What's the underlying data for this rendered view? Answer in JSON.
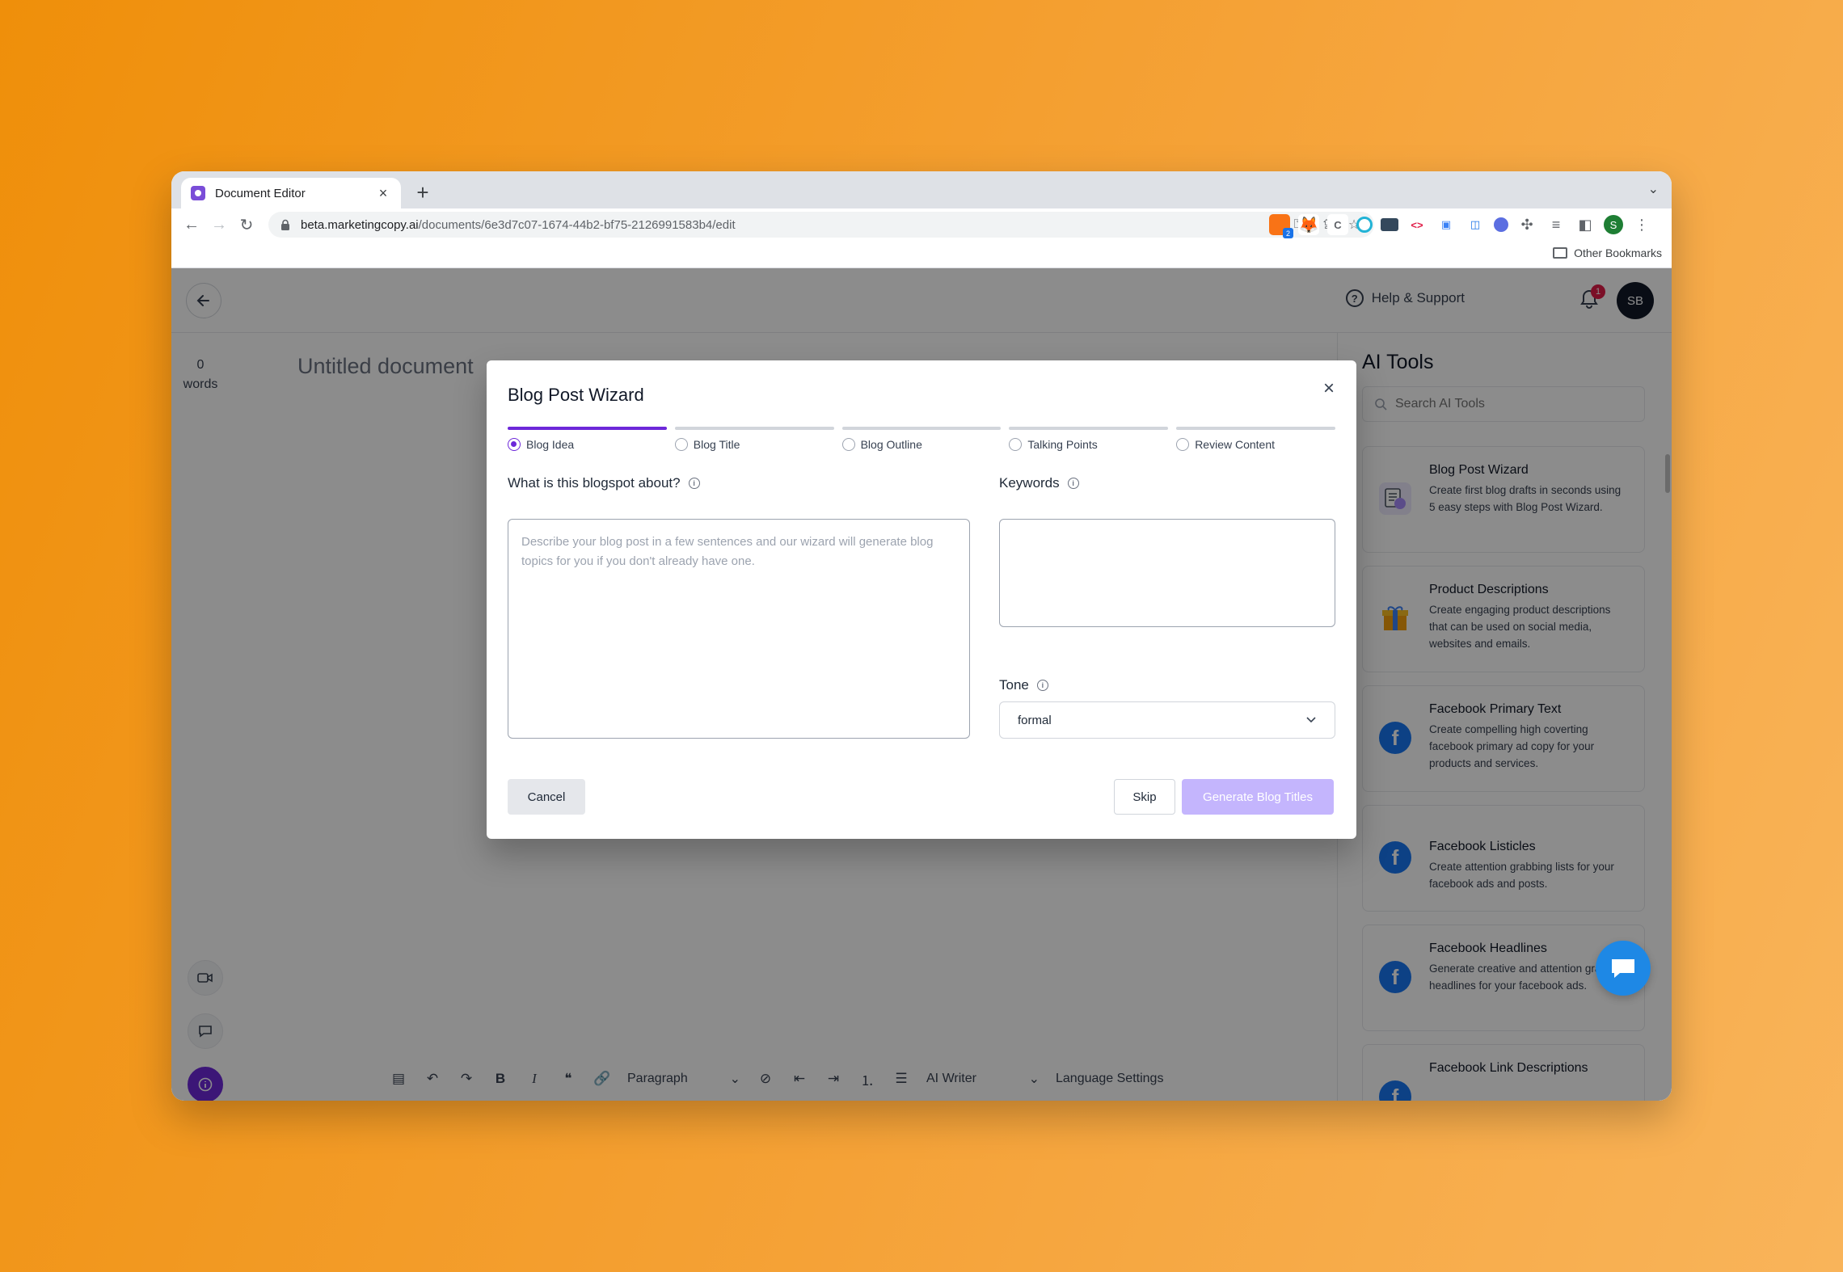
{
  "browser": {
    "tab_title": "Document Editor",
    "url_domain": "beta.marketingcopy.ai",
    "url_path": "/documents/6e3d7c07-1674-44b2-bf75-2126991583b4/edit",
    "bookmark_other": "Other Bookmarks",
    "profile_initial": "S",
    "extension_badge": "2"
  },
  "app": {
    "help_label": "Help & Support",
    "notification_count": "1",
    "user_initials": "SB",
    "word_count": "0",
    "word_count_label": "words",
    "document_title": "Untitled document"
  },
  "editor_toolbar": {
    "paragraph_label": "Paragraph",
    "ai_writer_label": "AI Writer",
    "language_settings_label": "Language Settings"
  },
  "ai_tools": {
    "title": "AI Tools",
    "search_placeholder": "Search AI Tools",
    "cards": [
      {
        "title": "Blog Post Wizard",
        "desc": "Create first blog drafts in seconds using 5 easy steps with Blog Post Wizard."
      },
      {
        "title": "Product Descriptions",
        "desc": "Create engaging product descriptions that can be used on social media, websites and emails."
      },
      {
        "title": "Facebook Primary Text",
        "desc": "Create compelling high coverting facebook primary ad copy for your products and services."
      },
      {
        "title": "Facebook Listicles",
        "desc": "Create attention grabbing lists for your facebook ads and posts."
      },
      {
        "title": "Facebook Headlines",
        "desc": "Generate creative and attention grabbing headlines for your facebook ads."
      },
      {
        "title": "Facebook Link Descriptions",
        "desc": ""
      }
    ]
  },
  "modal": {
    "title": "Blog Post Wizard",
    "steps": [
      "Blog Idea",
      "Blog Title",
      "Blog Outline",
      "Talking Points",
      "Review Content"
    ],
    "active_step": 0,
    "about_label": "What is this blogspot about?",
    "about_placeholder": "Describe your blog post in a few sentences and our wizard will generate blog topics for you if you don't already have one.",
    "keywords_label": "Keywords",
    "keywords_value": "",
    "tone_label": "Tone",
    "tone_value": "formal",
    "cancel_label": "Cancel",
    "skip_label": "Skip",
    "generate_label": "Generate Blog Titles"
  },
  "colors": {
    "accent": "#6d28d9",
    "accent_disabled": "#c4b5fd",
    "facebook": "#1877f2",
    "chat": "#1e88e5",
    "background_orange": "#f5a237"
  }
}
